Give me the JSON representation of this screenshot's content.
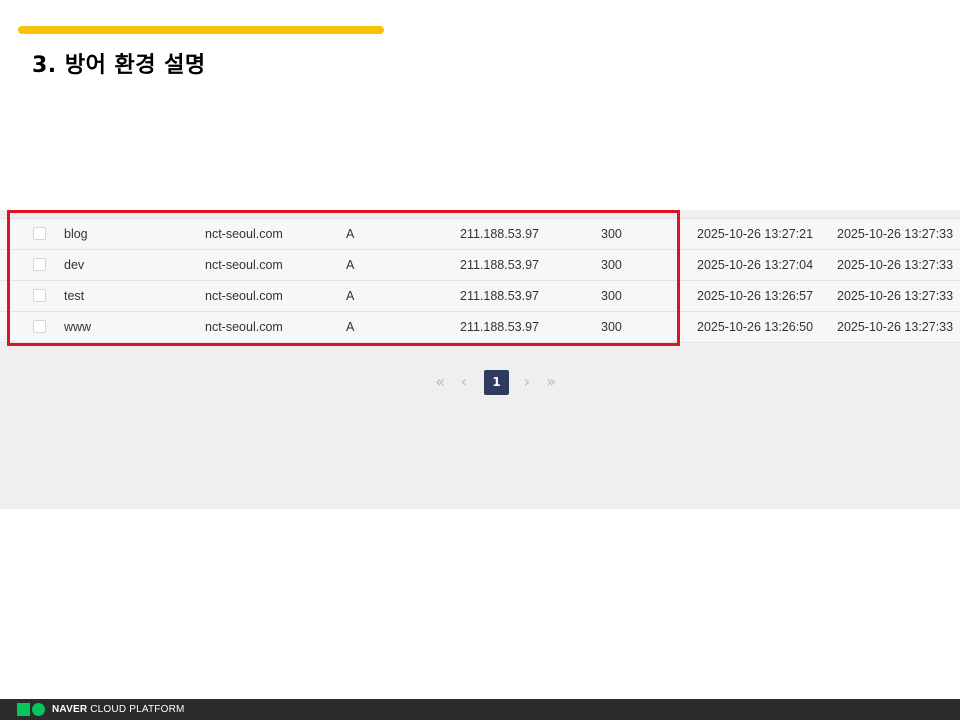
{
  "slide": {
    "title": "3. 방어 환경 설명",
    "accent_color": "#f9c20a"
  },
  "dns_records": [
    {
      "name": "blog",
      "domain": "nct-seoul.com",
      "type": "A",
      "value": "211.188.53.97",
      "ttl": "300",
      "created": "2025-10-26 13:27:21",
      "updated": "2025-10-26 13:27:33"
    },
    {
      "name": "dev",
      "domain": "nct-seoul.com",
      "type": "A",
      "value": "211.188.53.97",
      "ttl": "300",
      "created": "2025-10-26 13:27:04",
      "updated": "2025-10-26 13:27:33"
    },
    {
      "name": "test",
      "domain": "nct-seoul.com",
      "type": "A",
      "value": "211.188.53.97",
      "ttl": "300",
      "created": "2025-10-26 13:26:57",
      "updated": "2025-10-26 13:27:33"
    },
    {
      "name": "www",
      "domain": "nct-seoul.com",
      "type": "A",
      "value": "211.188.53.97",
      "ttl": "300",
      "created": "2025-10-26 13:26:50",
      "updated": "2025-10-26 13:27:33"
    }
  ],
  "pagination": {
    "current_page": "1",
    "first_icon": "double-chevron-left-icon",
    "prev_icon": "chevron-left-icon",
    "next_icon": "chevron-right-icon",
    "last_icon": "double-chevron-right-icon",
    "active_color": "#2e3b5e"
  },
  "highlight": {
    "color": "#e0141e"
  },
  "footer": {
    "brand_bold": "NAVER",
    "brand_light": "CLOUD PLATFORM",
    "logo_color": "#03c75a"
  }
}
